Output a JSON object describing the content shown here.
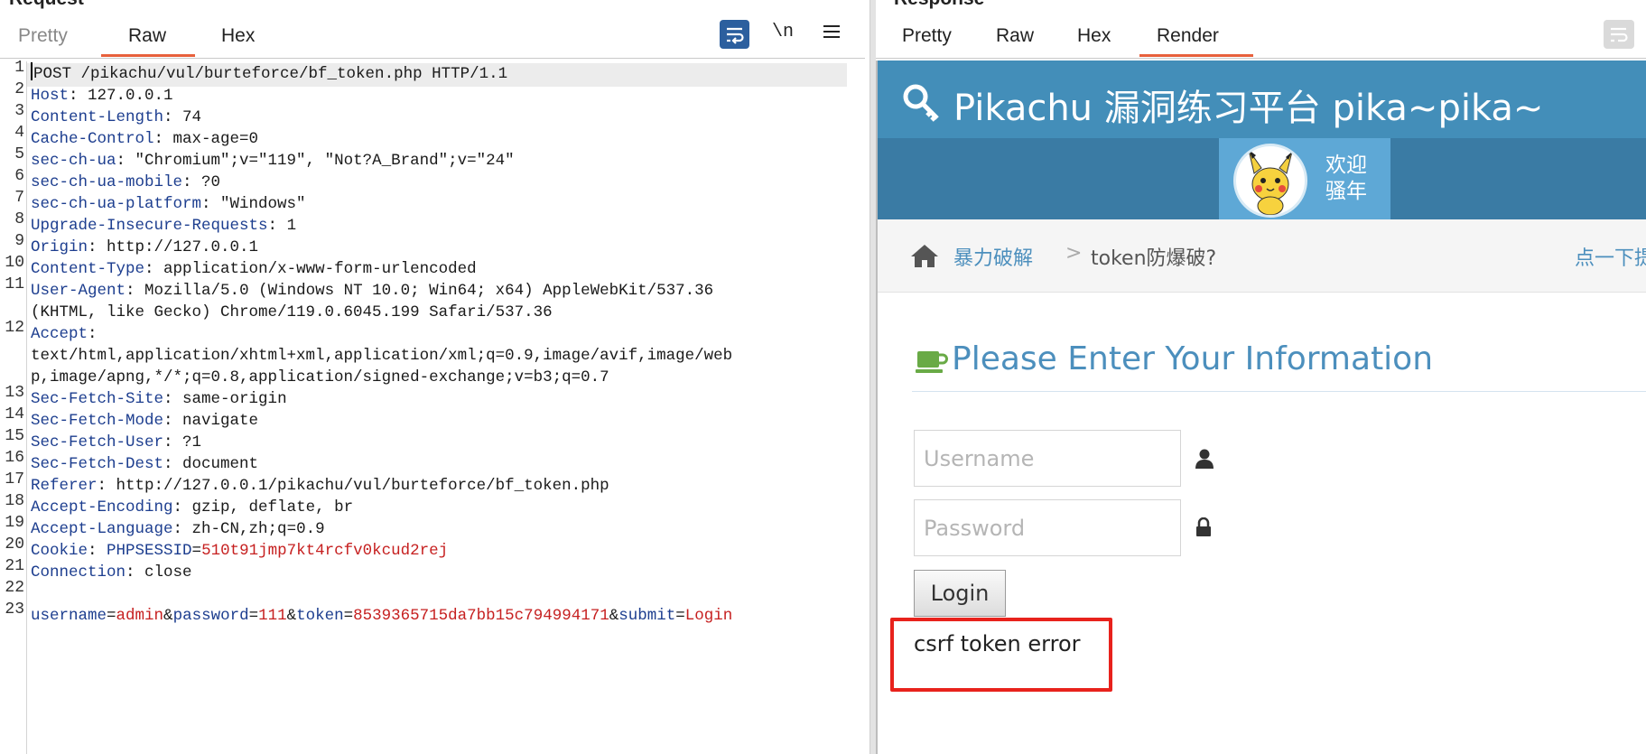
{
  "request": {
    "title": "Request",
    "tabs": [
      {
        "label": "Pretty"
      },
      {
        "label": "Raw"
      },
      {
        "label": "Hex"
      }
    ],
    "active_tab": "Raw",
    "toolbar": {
      "newline_label": "\\n"
    },
    "line_numbers": [
      "1",
      "2",
      "3",
      "4",
      "5",
      "6",
      "7",
      "8",
      "9",
      "10",
      "11",
      "12",
      "13",
      "14",
      "15",
      "16",
      "17",
      "18",
      "19",
      "20",
      "21",
      "22",
      "23"
    ],
    "lines": [
      {
        "text": "POST /pikachu/vul/burteforce/bf_token.php HTTP/1.1"
      },
      {
        "key": "Host",
        "value": "127.0.0.1"
      },
      {
        "key": "Content-Length",
        "value": "74"
      },
      {
        "key": "Cache-Control",
        "value": "max-age=0"
      },
      {
        "key": "sec-ch-ua",
        "value": "\"Chromium\";v=\"119\", \"Not?A_Brand\";v=\"24\""
      },
      {
        "key": "sec-ch-ua-mobile",
        "value": "?0"
      },
      {
        "key": "sec-ch-ua-platform",
        "value": "\"Windows\""
      },
      {
        "key": "Upgrade-Insecure-Requests",
        "value": "1"
      },
      {
        "key": "Origin",
        "value": "http://127.0.0.1"
      },
      {
        "key": "Content-Type",
        "value": "application/x-www-form-urlencoded"
      },
      {
        "key": "User-Agent",
        "value": "Mozilla/5.0 (Windows NT 10.0; Win64; x64) AppleWebKit/537.36",
        "cont": "(KHTML, like Gecko) Chrome/119.0.6045.199 Safari/537.36"
      },
      {
        "key": "Accept",
        "value": "",
        "cont": "text/html,application/xhtml+xml,application/xml;q=0.9,image/avif,image/web",
        "cont2": "p,image/apng,*/*;q=0.8,application/signed-exchange;v=b3;q=0.7"
      },
      {
        "key": "Sec-Fetch-Site",
        "value": "same-origin"
      },
      {
        "key": "Sec-Fetch-Mode",
        "value": "navigate"
      },
      {
        "key": "Sec-Fetch-User",
        "value": "?1"
      },
      {
        "key": "Sec-Fetch-Dest",
        "value": "document"
      },
      {
        "key": "Referer",
        "value": "http://127.0.0.1/pikachu/vul/burteforce/bf_token.php"
      },
      {
        "key": "Accept-Encoding",
        "value": "gzip, deflate, br"
      },
      {
        "key": "Accept-Language",
        "value": "zh-CN,zh;q=0.9"
      },
      {
        "key": "Cookie",
        "cookie_name": "PHPSESSID",
        "cookie_value": "510t91jmp7kt4rcfv0kcud2rej"
      },
      {
        "key": "Connection",
        "value": "close"
      }
    ],
    "body_params": [
      {
        "name": "username",
        "value": "admin"
      },
      {
        "name": "password",
        "value": "111"
      },
      {
        "name": "token",
        "value": "8539365715da7bb15c794994171"
      },
      {
        "name": "submit",
        "value": "Login"
      }
    ]
  },
  "response": {
    "title": "Response",
    "tabs": [
      {
        "label": "Pretty"
      },
      {
        "label": "Raw"
      },
      {
        "label": "Hex"
      },
      {
        "label": "Render"
      }
    ],
    "active_tab": "Render",
    "render": {
      "site_title": "Pikachu 漏洞练习平台 pika~pika~",
      "welcome_line1": "欢迎",
      "welcome_line2": "骚年",
      "breadcrumb_link": "暴力破解",
      "breadcrumb_sep": ">",
      "breadcrumb_current": "token防爆破?",
      "breadcrumb_right": "点一下提示~",
      "heading": "Please Enter Your Information",
      "username_placeholder": "Username",
      "password_placeholder": "Password",
      "login_button": "Login",
      "error_text": "csrf token error"
    }
  },
  "colors": {
    "accent_tab": "#e8603c",
    "header_blue": "#438eb9",
    "link_blue": "#4c8fbd",
    "error_border": "#e8221c",
    "header_key": "#1d3e8f",
    "param_value": "#c62020"
  },
  "icons": [
    "wrap-icon",
    "menu-icon",
    "key-icon",
    "avatar",
    "home-icon",
    "coffee-cup-icon",
    "user-icon",
    "lock-icon"
  ]
}
